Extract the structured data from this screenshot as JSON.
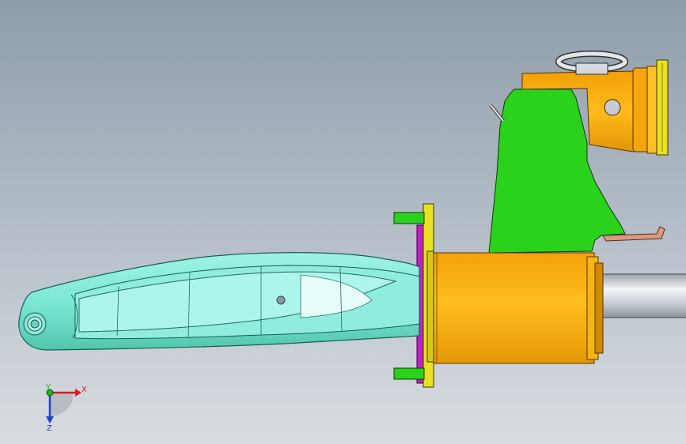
{
  "viewport": {
    "background_top": "#8e9caa",
    "background_bottom": "#d9dde1"
  },
  "part_colors": {
    "arm": "#7de8d4",
    "arm_dark": "#3aa78f",
    "bracket": "#2ad21c",
    "housing": "#ffb20a",
    "flange": "#e8e020",
    "plate": "#c020c8",
    "shaft": "#c7cdd6",
    "hook": "#d99a80",
    "eye": "#d8dadf"
  },
  "triad": {
    "x_label": "X",
    "y_label": "Y",
    "z_label": "Z",
    "x_color": "#d42020",
    "y_color": "#20b020",
    "z_color": "#2040c8"
  }
}
